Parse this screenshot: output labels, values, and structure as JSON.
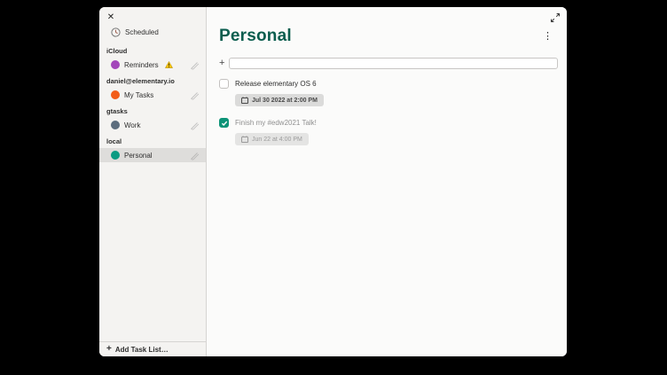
{
  "colors": {
    "title_teal": "#0b5d4e",
    "accent_checkbox": "#0c9377",
    "reminders_dot": "#a347ba",
    "my_tasks_dot": "#f25c19",
    "work_dot": "#5c6d7d",
    "personal_dot": "#0a9b82"
  },
  "sidebar": {
    "close_label": "✕",
    "scheduled_label": "Scheduled",
    "sections": [
      {
        "header": "iCloud",
        "items": [
          {
            "label": "Reminders",
            "dot": "#a347ba"
          }
        ]
      },
      {
        "header": "daniel@elementary.io",
        "items": [
          {
            "label": "My Tasks",
            "dot": "#f25c19"
          }
        ]
      },
      {
        "header": "gtasks",
        "items": [
          {
            "label": "Work",
            "dot": "#5c6d7d"
          }
        ]
      },
      {
        "header": "local",
        "items": [
          {
            "label": "Personal",
            "dot": "#0a9b82"
          }
        ]
      }
    ],
    "add_plus": "+",
    "add_task_list_label": "Add Task List…"
  },
  "main": {
    "title": "Personal",
    "menu_glyph": "⋮",
    "add_plus": "+",
    "new_task_value": "",
    "tasks": [
      {
        "label": "Release elementary OS 6",
        "completed": false,
        "due": "Jul 30 2022 at 2:00 PM"
      },
      {
        "label": "Finish my #edw2021 Talk!",
        "completed": true,
        "due": "Jun 22 at 4:00 PM"
      }
    ]
  }
}
